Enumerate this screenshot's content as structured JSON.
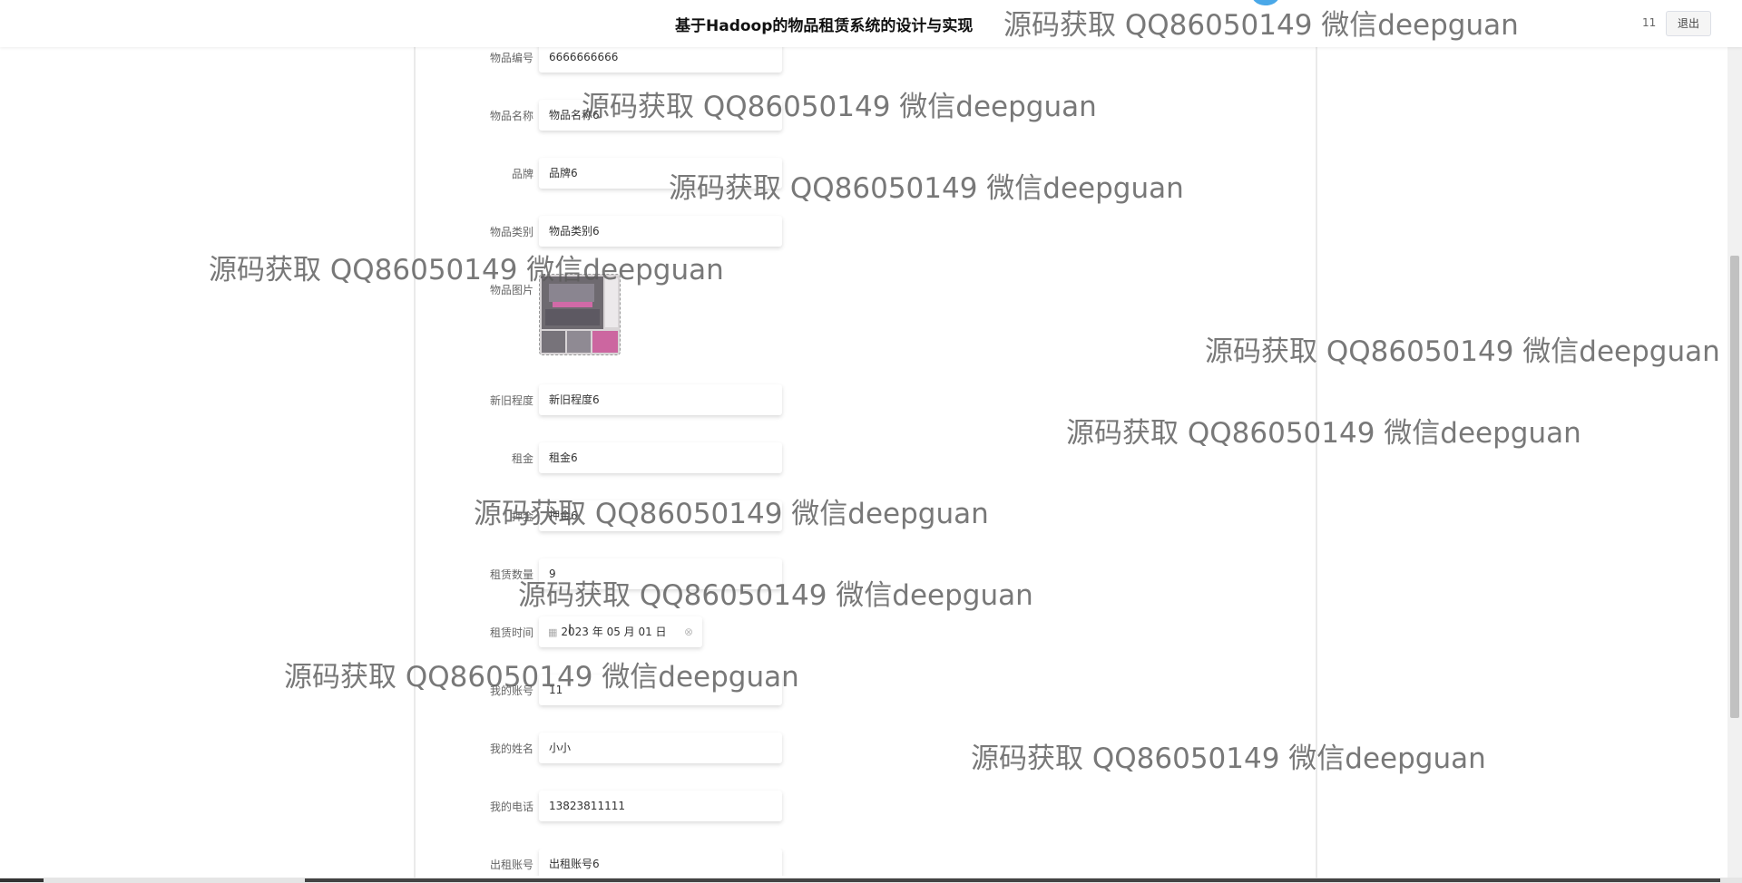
{
  "header": {
    "title": "基于Hadoop的物品租赁系统的设计与实现",
    "username": "11",
    "logout_label": "退出"
  },
  "form": {
    "item_no": {
      "label": "物品编号",
      "value": "6666666666"
    },
    "item_name": {
      "label": "物品名称",
      "value": "物品名称6"
    },
    "brand": {
      "label": "品牌",
      "value": "品牌6"
    },
    "category": {
      "label": "物品类别",
      "value": "物品类别6"
    },
    "image": {
      "label": "物品图片"
    },
    "condition": {
      "label": "新旧程度",
      "value": "新旧程度6"
    },
    "rent": {
      "label": "租金",
      "value": "租金6"
    },
    "deposit": {
      "label": "押金",
      "value": "押金6"
    },
    "quantity": {
      "label": "租赁数量",
      "value": "9"
    },
    "rent_date": {
      "label": "租赁时间",
      "value": "2023 年 05 月 01 日"
    },
    "my_account": {
      "label": "我的账号",
      "value": "11"
    },
    "my_name": {
      "label": "我的姓名",
      "value": "小小"
    },
    "my_phone": {
      "label": "我的电话",
      "value": "13823811111"
    },
    "lessor_account": {
      "label": "出租账号",
      "value": "出租账号6"
    }
  },
  "watermark": "源码获取 QQ86050149 微信deepguan"
}
